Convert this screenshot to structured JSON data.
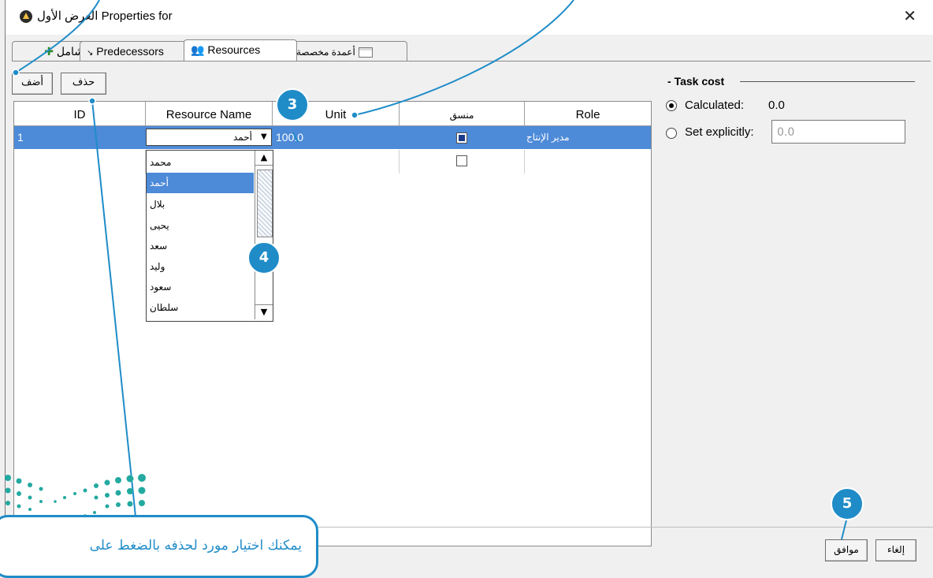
{
  "window": {
    "title": "العرض الأول Properties for",
    "close_glyph": "✕"
  },
  "tabs": [
    {
      "label": "شامل",
      "icon": "general-icon"
    },
    {
      "label": "Predecessors",
      "icon": "predecessors-icon"
    },
    {
      "label": "Resources",
      "icon": "resources-icon"
    },
    {
      "label": "أعمدة مخصصة",
      "icon": "custom-columns-icon"
    }
  ],
  "toolbar": {
    "add_label": "أضف",
    "delete_label": "حذف"
  },
  "table": {
    "columns": [
      "ID",
      "Resource Name",
      "Unit",
      "منسق",
      "Role"
    ],
    "rows": [
      {
        "id": "1",
        "resource_name": "أحمد",
        "unit": "100.0",
        "coordinator": true,
        "role": "مدير الإنتاج"
      },
      {
        "id": "",
        "resource_name": "",
        "unit": "",
        "coordinator": false,
        "role": ""
      }
    ]
  },
  "dropdown": {
    "selected": "أحمد",
    "options": [
      "محمد",
      "أحمد",
      "بلال",
      "يحيى",
      "سعد",
      "وليد",
      "سعود",
      "سلطان"
    ]
  },
  "task_cost": {
    "legend": "Task cost",
    "calculated_label": "Calculated:",
    "calculated_value": "0.0",
    "explicit_label": "Set explicitly:",
    "explicit_value": "0.0",
    "selected": "calculated"
  },
  "footer": {
    "ok_label": "موافق",
    "cancel_label": "إلغاء"
  },
  "annotations": {
    "badge_3": "3",
    "badge_4": "4",
    "badge_5": "5",
    "note_text": "يمكنك اختيار مورد لحذفه بالضغط على"
  },
  "colors": {
    "accent": "#1f8cc8",
    "selection": "#4d8ad8"
  }
}
